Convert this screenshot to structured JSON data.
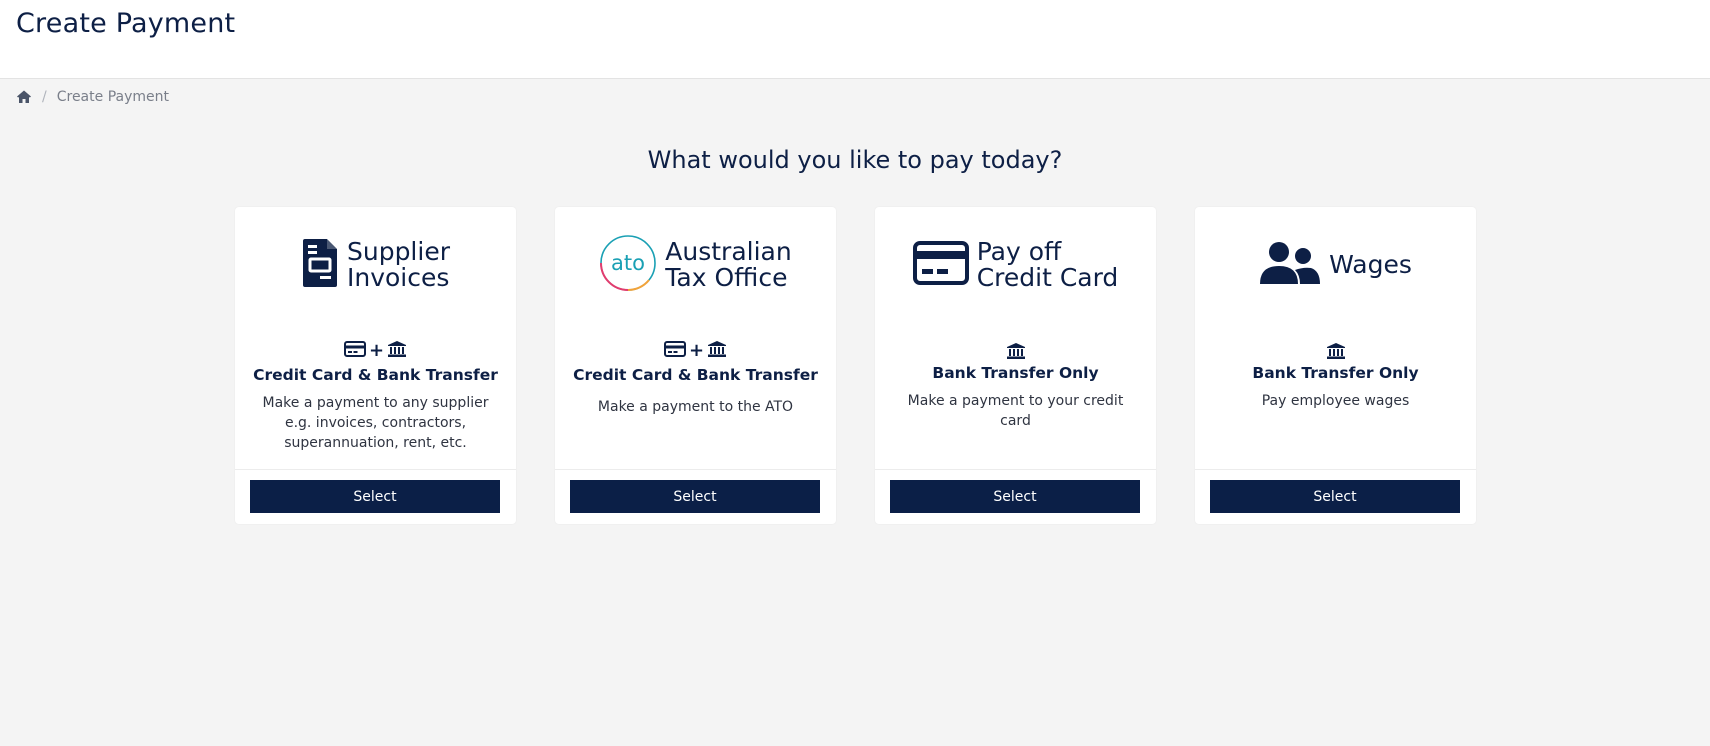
{
  "header": {
    "title": "Create Payment"
  },
  "breadcrumb": {
    "home_icon": "home-icon",
    "current": "Create Payment"
  },
  "main": {
    "question": "What would you like to pay today?",
    "cards": [
      {
        "title_line1": "Supplier",
        "title_line2": "Invoices",
        "icon": "document-icon",
        "method": "Credit Card & Bank Transfer",
        "method_icons": [
          "credit-card-icon",
          "plus",
          "bank-icon"
        ],
        "desc_lines": [
          "Make a payment to any supplier",
          "e.g. invoices, contractors,",
          "superannuation, rent, etc."
        ],
        "button": "Select"
      },
      {
        "title_line1": "Australian",
        "title_line2": "Tax Office",
        "icon": "ato-logo",
        "logo_text": "ato",
        "method": "Credit Card & Bank Transfer",
        "method_icons": [
          "credit-card-icon",
          "plus",
          "bank-icon"
        ],
        "desc_lines": [
          "Make a payment to the ATO"
        ],
        "button": "Select"
      },
      {
        "title_line1": "Pay off",
        "title_line2": "Credit Card",
        "icon": "credit-card-icon",
        "method": "Bank Transfer Only",
        "method_icons": [
          "bank-icon"
        ],
        "desc_lines": [
          "Make a payment to your credit",
          "card"
        ],
        "button": "Select"
      },
      {
        "title_line1": "Wages",
        "icon": "users-icon",
        "method": "Bank Transfer Only",
        "method_icons": [
          "bank-icon"
        ],
        "desc_lines": [
          "Pay employee wages"
        ],
        "button": "Select"
      }
    ]
  },
  "colors": {
    "primary": "#0b1f47",
    "background": "#f4f4f4",
    "ato_teal": "#1aa0b4"
  }
}
